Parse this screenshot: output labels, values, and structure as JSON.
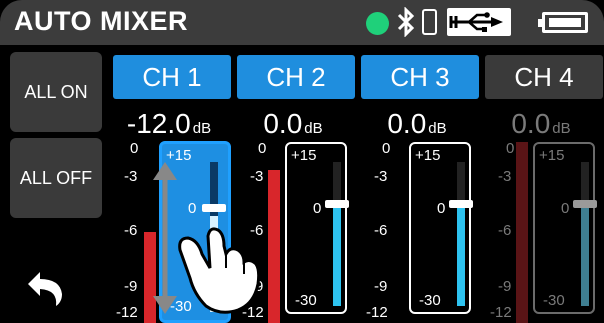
{
  "header": {
    "title": "AUTO MIXER",
    "status_color": "#1fd07a",
    "icons": [
      "status-dot-icon",
      "bluetooth-icon",
      "phone-icon",
      "usb-icon",
      "battery-icon"
    ]
  },
  "side": {
    "all_on": "ALL ON",
    "all_off": "ALL OFF",
    "back_icon": "back-arrow-icon"
  },
  "channels": [
    {
      "label": "CH 1",
      "gain": "-12.0",
      "unit": "dB",
      "active": true,
      "fader_top": "+15",
      "fader_mid": "0",
      "fader_bottom": "-30",
      "scale": [
        "0",
        "-3",
        "-6",
        "-9",
        "-12"
      ]
    },
    {
      "label": "CH 2",
      "gain": "0.0",
      "unit": "dB",
      "active": false,
      "fader_top": "+15",
      "fader_mid": "0",
      "fader_bottom": "-30",
      "scale": [
        "0",
        "-3",
        "-6",
        "-9",
        "-12"
      ]
    },
    {
      "label": "CH 3",
      "gain": "0.0",
      "unit": "dB",
      "active": false,
      "fader_top": "+15",
      "fader_mid": "0",
      "fader_bottom": "-30",
      "scale": [
        "0",
        "-3",
        "-6",
        "-9",
        "-12"
      ]
    },
    {
      "label": "CH 4",
      "gain": "0.0",
      "unit": "dB",
      "active": false,
      "fader_top": "+15",
      "fader_mid": "0",
      "fader_bottom": "-30",
      "scale": [
        "0",
        "-3",
        "-6",
        "-9",
        "-12"
      ]
    }
  ],
  "colors": {
    "accent": "#1f8ede",
    "meter": "#d8262b",
    "fader_fill": "#2ec3f0"
  }
}
